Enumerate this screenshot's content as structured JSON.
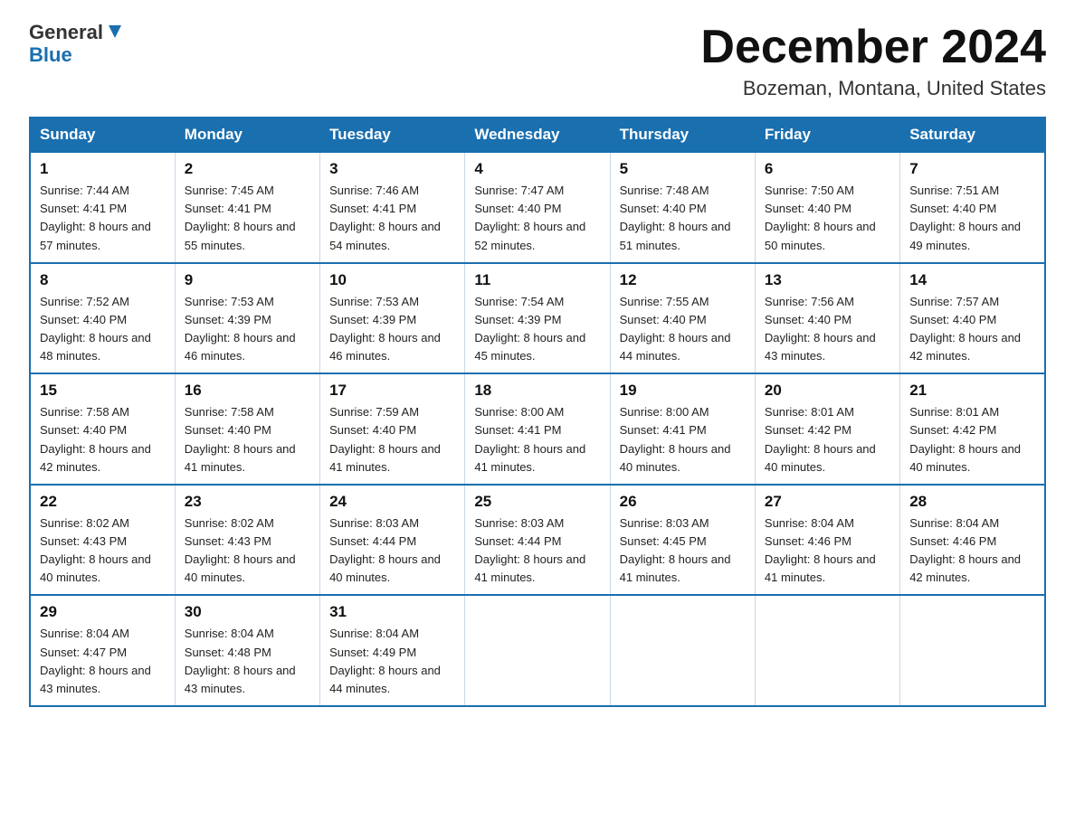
{
  "header": {
    "logo_line1": "General",
    "logo_line2": "Blue",
    "main_title": "December 2024",
    "subtitle": "Bozeman, Montana, United States"
  },
  "calendar": {
    "days_of_week": [
      "Sunday",
      "Monday",
      "Tuesday",
      "Wednesday",
      "Thursday",
      "Friday",
      "Saturday"
    ],
    "weeks": [
      [
        {
          "day": "1",
          "sunrise": "7:44 AM",
          "sunset": "4:41 PM",
          "daylight": "8 hours and 57 minutes."
        },
        {
          "day": "2",
          "sunrise": "7:45 AM",
          "sunset": "4:41 PM",
          "daylight": "8 hours and 55 minutes."
        },
        {
          "day": "3",
          "sunrise": "7:46 AM",
          "sunset": "4:41 PM",
          "daylight": "8 hours and 54 minutes."
        },
        {
          "day": "4",
          "sunrise": "7:47 AM",
          "sunset": "4:40 PM",
          "daylight": "8 hours and 52 minutes."
        },
        {
          "day": "5",
          "sunrise": "7:48 AM",
          "sunset": "4:40 PM",
          "daylight": "8 hours and 51 minutes."
        },
        {
          "day": "6",
          "sunrise": "7:50 AM",
          "sunset": "4:40 PM",
          "daylight": "8 hours and 50 minutes."
        },
        {
          "day": "7",
          "sunrise": "7:51 AM",
          "sunset": "4:40 PM",
          "daylight": "8 hours and 49 minutes."
        }
      ],
      [
        {
          "day": "8",
          "sunrise": "7:52 AM",
          "sunset": "4:40 PM",
          "daylight": "8 hours and 48 minutes."
        },
        {
          "day": "9",
          "sunrise": "7:53 AM",
          "sunset": "4:39 PM",
          "daylight": "8 hours and 46 minutes."
        },
        {
          "day": "10",
          "sunrise": "7:53 AM",
          "sunset": "4:39 PM",
          "daylight": "8 hours and 46 minutes."
        },
        {
          "day": "11",
          "sunrise": "7:54 AM",
          "sunset": "4:39 PM",
          "daylight": "8 hours and 45 minutes."
        },
        {
          "day": "12",
          "sunrise": "7:55 AM",
          "sunset": "4:40 PM",
          "daylight": "8 hours and 44 minutes."
        },
        {
          "day": "13",
          "sunrise": "7:56 AM",
          "sunset": "4:40 PM",
          "daylight": "8 hours and 43 minutes."
        },
        {
          "day": "14",
          "sunrise": "7:57 AM",
          "sunset": "4:40 PM",
          "daylight": "8 hours and 42 minutes."
        }
      ],
      [
        {
          "day": "15",
          "sunrise": "7:58 AM",
          "sunset": "4:40 PM",
          "daylight": "8 hours and 42 minutes."
        },
        {
          "day": "16",
          "sunrise": "7:58 AM",
          "sunset": "4:40 PM",
          "daylight": "8 hours and 41 minutes."
        },
        {
          "day": "17",
          "sunrise": "7:59 AM",
          "sunset": "4:40 PM",
          "daylight": "8 hours and 41 minutes."
        },
        {
          "day": "18",
          "sunrise": "8:00 AM",
          "sunset": "4:41 PM",
          "daylight": "8 hours and 41 minutes."
        },
        {
          "day": "19",
          "sunrise": "8:00 AM",
          "sunset": "4:41 PM",
          "daylight": "8 hours and 40 minutes."
        },
        {
          "day": "20",
          "sunrise": "8:01 AM",
          "sunset": "4:42 PM",
          "daylight": "8 hours and 40 minutes."
        },
        {
          "day": "21",
          "sunrise": "8:01 AM",
          "sunset": "4:42 PM",
          "daylight": "8 hours and 40 minutes."
        }
      ],
      [
        {
          "day": "22",
          "sunrise": "8:02 AM",
          "sunset": "4:43 PM",
          "daylight": "8 hours and 40 minutes."
        },
        {
          "day": "23",
          "sunrise": "8:02 AM",
          "sunset": "4:43 PM",
          "daylight": "8 hours and 40 minutes."
        },
        {
          "day": "24",
          "sunrise": "8:03 AM",
          "sunset": "4:44 PM",
          "daylight": "8 hours and 40 minutes."
        },
        {
          "day": "25",
          "sunrise": "8:03 AM",
          "sunset": "4:44 PM",
          "daylight": "8 hours and 41 minutes."
        },
        {
          "day": "26",
          "sunrise": "8:03 AM",
          "sunset": "4:45 PM",
          "daylight": "8 hours and 41 minutes."
        },
        {
          "day": "27",
          "sunrise": "8:04 AM",
          "sunset": "4:46 PM",
          "daylight": "8 hours and 41 minutes."
        },
        {
          "day": "28",
          "sunrise": "8:04 AM",
          "sunset": "4:46 PM",
          "daylight": "8 hours and 42 minutes."
        }
      ],
      [
        {
          "day": "29",
          "sunrise": "8:04 AM",
          "sunset": "4:47 PM",
          "daylight": "8 hours and 43 minutes."
        },
        {
          "day": "30",
          "sunrise": "8:04 AM",
          "sunset": "4:48 PM",
          "daylight": "8 hours and 43 minutes."
        },
        {
          "day": "31",
          "sunrise": "8:04 AM",
          "sunset": "4:49 PM",
          "daylight": "8 hours and 44 minutes."
        },
        null,
        null,
        null,
        null
      ]
    ]
  }
}
